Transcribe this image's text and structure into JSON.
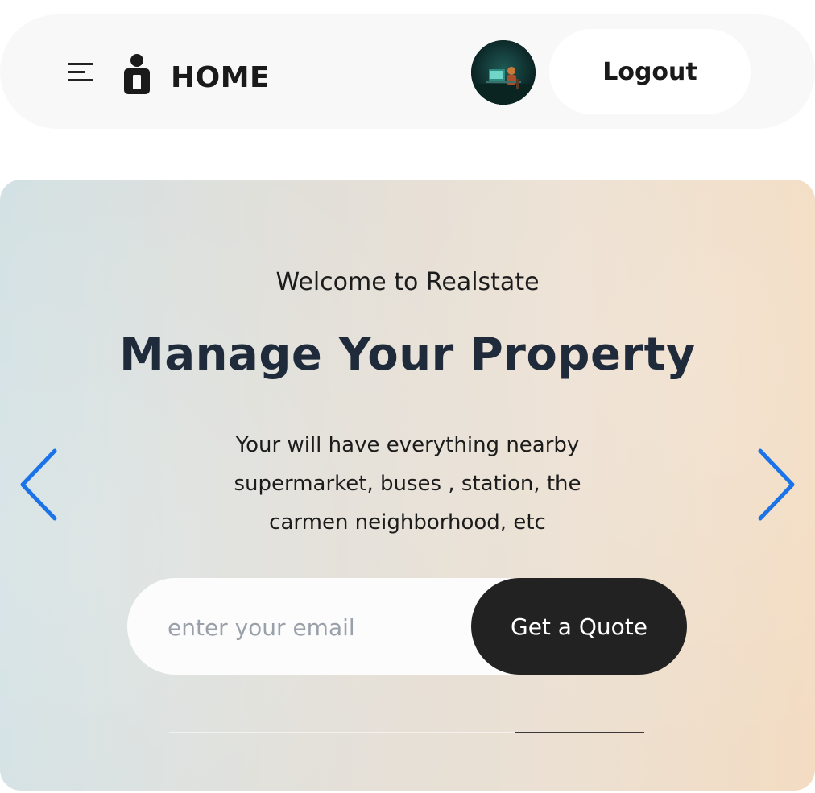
{
  "header": {
    "brand": "HOME",
    "logout_label": "Logout",
    "icons": {
      "menu": "hamburger-menu-icon",
      "brand": "person-icon",
      "avatar": "user-avatar"
    }
  },
  "hero": {
    "welcome": "Welcome to Realstate",
    "headline": "Manage Your Property",
    "subtitle": "Your will have everything nearby supermarket, buses , station, the carmen neighborhood, etc",
    "email_placeholder": "enter your email",
    "cta_label": "Get a Quote",
    "arrows": {
      "prev": "chevron-left-icon",
      "next": "chevron-right-icon"
    }
  },
  "colors": {
    "accent_arrow": "#1a73e8",
    "cta_bg": "#222222",
    "headline": "#1f2a3a"
  }
}
